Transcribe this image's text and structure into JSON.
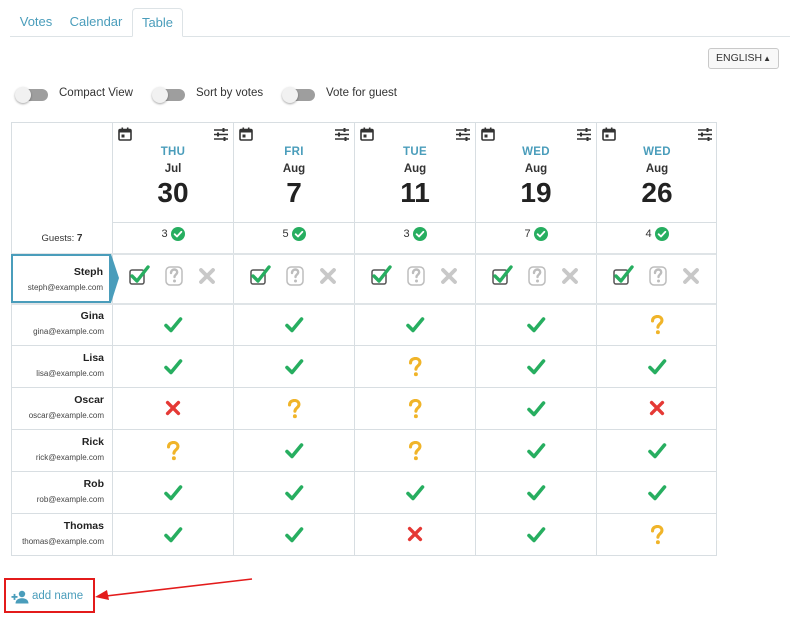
{
  "tabs": [
    {
      "label": "Votes",
      "active": false
    },
    {
      "label": "Calendar",
      "active": false
    },
    {
      "label": "Table",
      "active": true
    }
  ],
  "language": {
    "selected": "ENGLISH"
  },
  "toggles": [
    {
      "label": "Compact View",
      "on": false
    },
    {
      "label": "Sort by votes",
      "on": false
    },
    {
      "label": "Vote for guest",
      "on": false
    }
  ],
  "guests": {
    "label": "Guests:",
    "count": "7"
  },
  "dates": [
    {
      "dow": "THU",
      "month": "Jul",
      "day": "30",
      "yes_count": "3"
    },
    {
      "dow": "FRI",
      "month": "Aug",
      "day": "7",
      "yes_count": "5"
    },
    {
      "dow": "TUE",
      "month": "Aug",
      "day": "11",
      "yes_count": "3"
    },
    {
      "dow": "WED",
      "month": "Aug",
      "day": "19",
      "yes_count": "7"
    },
    {
      "dow": "WED",
      "month": "Aug",
      "day": "26",
      "yes_count": "4"
    }
  ],
  "current_user": {
    "name": "Steph",
    "email": "steph@example.com",
    "votes": [
      "yes",
      "yes",
      "yes",
      "yes",
      "yes"
    ]
  },
  "participants": [
    {
      "name": "Gina",
      "email": "gina@example.com",
      "votes": [
        "yes",
        "yes",
        "yes",
        "yes",
        "maybe"
      ]
    },
    {
      "name": "Lisa",
      "email": "lisa@example.com",
      "votes": [
        "yes",
        "yes",
        "maybe",
        "yes",
        "yes"
      ]
    },
    {
      "name": "Oscar",
      "email": "oscar@example.com",
      "votes": [
        "no",
        "maybe",
        "maybe",
        "yes",
        "no"
      ]
    },
    {
      "name": "Rick",
      "email": "rick@example.com",
      "votes": [
        "maybe",
        "yes",
        "maybe",
        "yes",
        "yes"
      ]
    },
    {
      "name": "Rob",
      "email": "rob@example.com",
      "votes": [
        "yes",
        "yes",
        "yes",
        "yes",
        "yes"
      ]
    },
    {
      "name": "Thomas",
      "email": "thomas@example.com",
      "votes": [
        "yes",
        "yes",
        "no",
        "yes",
        "maybe"
      ]
    }
  ],
  "add_name": {
    "label": "add name"
  },
  "icons": {
    "calendar": "calendar-icon",
    "options": "sliders-icon",
    "yes": "check-icon",
    "maybe": "question-icon",
    "no": "cross-icon",
    "add_user": "add-user-icon"
  },
  "colors": {
    "accent": "#4a9dbb",
    "yes": "#27ae60",
    "maybe": "#f0b429",
    "no": "#e53935",
    "highlight": "#e31b1b"
  }
}
